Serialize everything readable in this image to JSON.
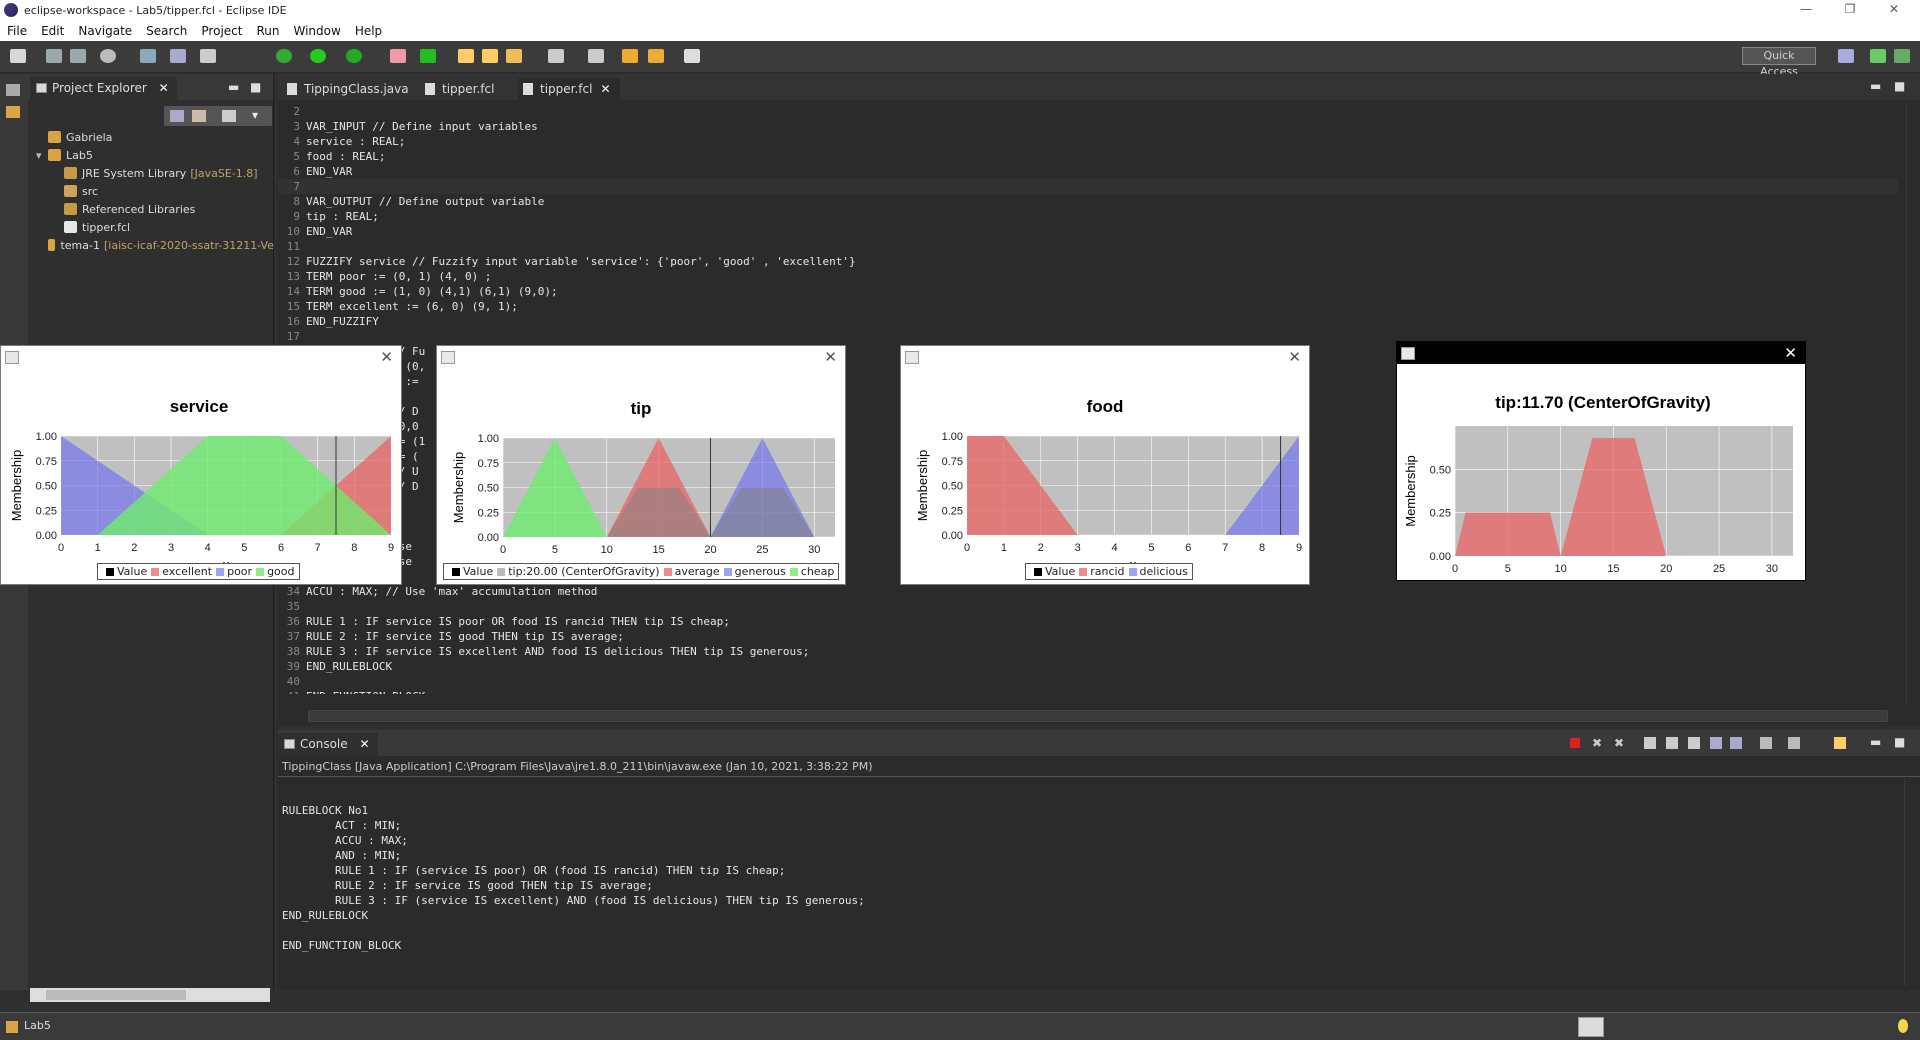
{
  "window": {
    "title": "eclipse-workspace - Lab5/tipper.fcl - Eclipse IDE"
  },
  "menu": [
    "File",
    "Edit",
    "Navigate",
    "Search",
    "Project",
    "Run",
    "Window",
    "Help"
  ],
  "toolbar": {
    "quick_access": "Quick Access"
  },
  "explorer": {
    "tab_label": "Project Explorer",
    "items": [
      {
        "label": "Gabriela",
        "detail": ""
      },
      {
        "label": "Lab5",
        "detail": ""
      },
      {
        "label": "JRE System Library",
        "detail": "[JavaSE-1.8]"
      },
      {
        "label": "src",
        "detail": ""
      },
      {
        "label": "Referenced Libraries",
        "detail": ""
      },
      {
        "label": "tipper.fcl",
        "detail": ""
      },
      {
        "label": "tema-1",
        "detail": "[iaisc-icaf-2020-ssatr-31211-Ve"
      }
    ]
  },
  "editor": {
    "tabs": [
      "TippingClass.java",
      "tipper.fcl",
      "tipper.fcl"
    ],
    "lines": [
      {
        "n": "2",
        "t": ""
      },
      {
        "n": "3",
        "t": "VAR_INPUT // Define input variables"
      },
      {
        "n": "4",
        "t": "service : REAL;"
      },
      {
        "n": "5",
        "t": "food : REAL;"
      },
      {
        "n": "6",
        "t": "END_VAR"
      },
      {
        "n": "7",
        "t": ""
      },
      {
        "n": "8",
        "t": "VAR_OUTPUT // Define output variable"
      },
      {
        "n": "9",
        "t": "tip : REAL;"
      },
      {
        "n": "10",
        "t": "END_VAR"
      },
      {
        "n": "11",
        "t": ""
      },
      {
        "n": "12",
        "t": "FUZZIFY service // Fuzzify input variable 'service': {'poor', 'good' , 'excellent'}"
      },
      {
        "n": "13",
        "t": "TERM poor := (0, 1) (4, 0) ;"
      },
      {
        "n": "14",
        "t": "TERM good := (1, 0) (4,1) (6,1) (9,0);"
      },
      {
        "n": "15",
        "t": "TERM excellent := (6, 0) (9, 1);"
      },
      {
        "n": "16",
        "t": "END_FUZZIFY"
      },
      {
        "n": "17",
        "t": ""
      },
      {
        "n": "18",
        "t": "             // Fu"
      },
      {
        "n": "19",
        "t": "             = (0,"
      },
      {
        "n": "20",
        "t": "             s :="
      },
      {
        "n": "21",
        "t": ""
      },
      {
        "n": "22",
        "t": "             // D                                                                            erous' }"
      },
      {
        "n": "23",
        "t": "             (0,0"
      },
      {
        "n": "24",
        "t": "             := (1"
      },
      {
        "n": "25",
        "t": "             := ("
      },
      {
        "n": "26",
        "t": "             // U"
      },
      {
        "n": "27",
        "t": "             // D"
      },
      {
        "n": "28",
        "t": ""
      },
      {
        "n": "29",
        "t": ""
      },
      {
        "n": "30",
        "t": ""
      },
      {
        "n": "31",
        "t": "             Use                                                                          ll DeMor"
      },
      {
        "n": "32",
        "t": "             Use"
      },
      {
        "n": "33",
        "t": ""
      },
      {
        "n": "34",
        "t": "ACCU : MAX; // Use 'max' accumulation method"
      },
      {
        "n": "35",
        "t": ""
      },
      {
        "n": "36",
        "t": "RULE 1 : IF service IS poor OR food IS rancid THEN tip IS cheap;"
      },
      {
        "n": "37",
        "t": "RULE 2 : IF service IS good THEN tip IS average;"
      },
      {
        "n": "38",
        "t": "RULE 3 : IF service IS excellent AND food IS delicious THEN tip IS generous;"
      },
      {
        "n": "39",
        "t": "END_RULEBLOCK"
      },
      {
        "n": "40",
        "t": ""
      },
      {
        "n": "41",
        "t": "END_FUNCTION_BLOCK"
      }
    ]
  },
  "console": {
    "tab_label": "Console",
    "description": "TippingClass [Java Application] C:\\Program Files\\Java\\jre1.8.0_211\\bin\\javaw.exe (Jan 10, 2021, 3:38:22 PM)",
    "lines": [
      "",
      "RULEBLOCK No1",
      "        ACT : MIN;",
      "        ACCU : MAX;",
      "        AND : MIN;",
      "        RULE 1 : IF (service IS poor) OR (food IS rancid) THEN tip IS cheap;",
      "        RULE 2 : IF service IS good THEN tip IS average;",
      "        RULE 3 : IF (service IS excellent) AND (food IS delicious) THEN tip IS generous;",
      "END_RULEBLOCK",
      "",
      "END_FUNCTION_BLOCK"
    ]
  },
  "status": {
    "selection": "Lab5"
  },
  "colors": {
    "red": "#e57373",
    "blue": "#7878e8",
    "green": "#80e080",
    "plot_bg": "#c0c0c0"
  },
  "chart_data": [
    {
      "type": "area",
      "title": "service",
      "xlabel": "x",
      "ylabel": "Membership",
      "xlim": [
        0,
        9
      ],
      "ylim": [
        0,
        1
      ],
      "xticks": [
        "0",
        "1",
        "2",
        "3",
        "4",
        "5",
        "6",
        "7",
        "8",
        "9"
      ],
      "yticks": [
        "0.00",
        "0.25",
        "0.50",
        "0.75",
        "1.00"
      ],
      "value_marker": 7.5,
      "series": [
        {
          "name": "excellent",
          "color": "red",
          "points": [
            [
              6,
              0
            ],
            [
              9,
              1
            ],
            [
              9,
              0
            ]
          ]
        },
        {
          "name": "poor",
          "color": "blue",
          "points": [
            [
              0,
              1
            ],
            [
              4,
              0
            ]
          ]
        },
        {
          "name": "good",
          "color": "green",
          "points": [
            [
              1,
              0
            ],
            [
              4,
              1
            ],
            [
              6,
              1
            ],
            [
              9,
              0
            ]
          ]
        }
      ],
      "legend": [
        "Value",
        "excellent",
        "poor",
        "good"
      ]
    },
    {
      "type": "area",
      "title": "tip",
      "xlabel": "x",
      "ylabel": "Membership",
      "xlim": [
        0,
        32
      ],
      "ylim": [
        0,
        1
      ],
      "xticks": [
        "0",
        "5",
        "10",
        "15",
        "20",
        "25",
        "30"
      ],
      "yticks": [
        "0.00",
        "0.25",
        "0.50",
        "0.75",
        "1.00"
      ],
      "value_marker": 20,
      "series": [
        {
          "name": "average",
          "color": "red",
          "points": [
            [
              10,
              0
            ],
            [
              15,
              1
            ],
            [
              20,
              0
            ]
          ]
        },
        {
          "name": "generous",
          "color": "blue",
          "points": [
            [
              20,
              0
            ],
            [
              25,
              1
            ],
            [
              30,
              0
            ]
          ]
        },
        {
          "name": "cheap",
          "color": "green",
          "points": [
            [
              0,
              0
            ],
            [
              5,
              1
            ],
            [
              10,
              0
            ]
          ]
        },
        {
          "name": "tip:20.00 (CenterOfGravity)",
          "color": "gray",
          "points": [
            [
              10,
              0
            ],
            [
              13,
              0.5
            ],
            [
              17,
              0.5
            ],
            [
              20,
              0
            ],
            [
              23,
              0.5
            ],
            [
              27,
              0.5
            ],
            [
              30,
              0
            ]
          ]
        }
      ],
      "legend": [
        "Value",
        "tip:20.00 (CenterOfGravity)",
        "average",
        "generous",
        "cheap"
      ]
    },
    {
      "type": "area",
      "title": "food",
      "xlabel": "x",
      "ylabel": "Membership",
      "xlim": [
        0,
        9
      ],
      "ylim": [
        0,
        1
      ],
      "xticks": [
        "0",
        "1",
        "2",
        "3",
        "4",
        "5",
        "6",
        "7",
        "8",
        "9"
      ],
      "yticks": [
        "0.00",
        "0.25",
        "0.50",
        "0.75",
        "1.00"
      ],
      "value_marker": 8.5,
      "series": [
        {
          "name": "rancid",
          "color": "red",
          "points": [
            [
              0,
              1
            ],
            [
              1,
              1
            ],
            [
              3,
              0
            ]
          ]
        },
        {
          "name": "delicious",
          "color": "blue",
          "points": [
            [
              7,
              0
            ],
            [
              9,
              1
            ],
            [
              9,
              0
            ]
          ]
        }
      ],
      "legend": [
        "Value",
        "rancid",
        "delicious"
      ]
    },
    {
      "type": "area",
      "title": "tip:11.70 (CenterOfGravity)",
      "xlabel": "x",
      "ylabel": "Membership",
      "xlim": [
        0,
        32
      ],
      "ylim": [
        0,
        0.75
      ],
      "xticks": [
        "0",
        "5",
        "10",
        "15",
        "20",
        "25",
        "30"
      ],
      "yticks": [
        "0.00",
        "0.25",
        "0.50"
      ],
      "series": [
        {
          "name": "tip",
          "color": "red",
          "points": [
            [
              0,
              0
            ],
            [
              1,
              0.25
            ],
            [
              9,
              0.25
            ],
            [
              10,
              0
            ],
            [
              13,
              0.68
            ],
            [
              17,
              0.68
            ],
            [
              20,
              0
            ]
          ]
        }
      ],
      "legend": []
    }
  ]
}
